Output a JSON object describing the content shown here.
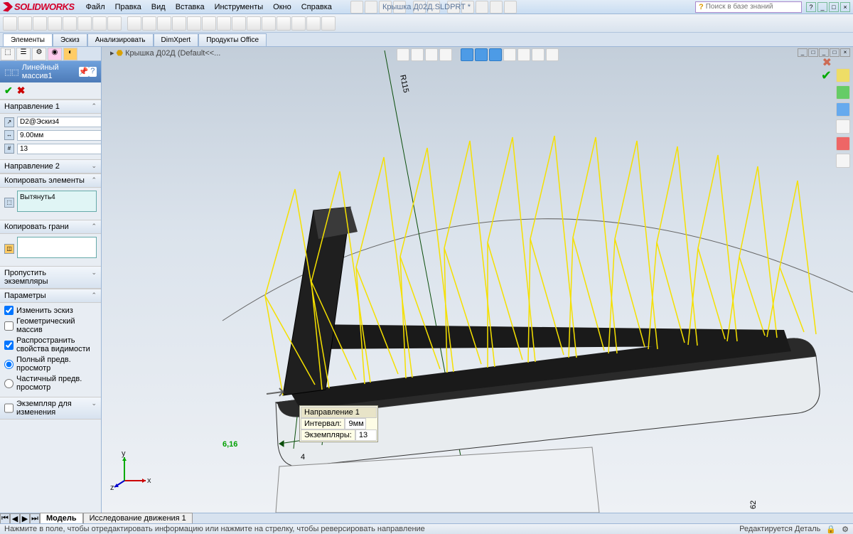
{
  "app": {
    "name": "SOLIDWORKS",
    "doc_title": "Крышка Д02Д.SLDPRT *"
  },
  "menu": [
    "Файл",
    "Правка",
    "Вид",
    "Вставка",
    "Инструменты",
    "Окно",
    "Справка"
  ],
  "search": {
    "placeholder": "Поиск в базе знаний"
  },
  "tabs_top": [
    "Элементы",
    "Эскиз",
    "Анализировать",
    "DimXpert",
    "Продукты Office"
  ],
  "breadcrumb": "Крышка Д02Д  (Default<<...",
  "feature": {
    "name": "Линейный массив1",
    "sections": {
      "dir1": {
        "title": "Направление 1",
        "edge": "D2@Эскиз4",
        "spacing": "9.00мм",
        "count": "13"
      },
      "dir2": {
        "title": "Направление 2"
      },
      "copy_el": {
        "title": "Копировать элементы",
        "item": "Вытянуть4"
      },
      "copy_faces": {
        "title": "Копировать грани"
      },
      "skip": {
        "title": "Пропустить экземпляры"
      },
      "params": {
        "title": "Параметры",
        "opt_sketch": "Изменить эскиз",
        "opt_geom": "Геометрический массив",
        "opt_prop": "Распространить свойства видимости",
        "opt_full": "Полный предв. просмотр",
        "opt_part": "Частичный предв. просмотр"
      },
      "inst": {
        "title": "Экземпляр для изменения"
      }
    }
  },
  "callout": {
    "title": "Направление 1",
    "r1_label": "Интервал:",
    "r1_val": "9мм",
    "r2_label": "Экземпляры:",
    "r2_val": "13"
  },
  "annotations": {
    "radius": "R115",
    "dim1": "6,16",
    "dim2": "4",
    "dim3": "62"
  },
  "bottom_tabs": {
    "model": "Модель",
    "motion": "Исследование движения 1"
  },
  "status": {
    "hint": "Нажмите в поле, чтобы отредактировать информацию или нажмите на стрелку, чтобы реверсировать направление",
    "mode": "Редактируется Деталь"
  },
  "triad": {
    "x": "x",
    "y": "y",
    "z": "z"
  }
}
